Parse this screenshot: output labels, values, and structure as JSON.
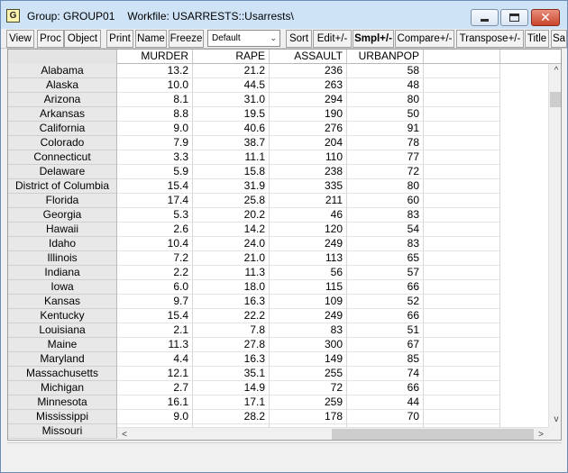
{
  "window": {
    "title_group": "Group: GROUP01",
    "title_workfile": "Workfile: USARRESTS::Usarrests\\",
    "app_icon_letter": "G"
  },
  "toolbar": {
    "view": "View",
    "proc": "Proc",
    "object": "Object",
    "print": "Print",
    "name": "Name",
    "freeze": "Freeze",
    "format_dropdown": "Default",
    "sort": "Sort",
    "edit": "Edit+/-",
    "smpl": "Smpl+/-",
    "compare": "Compare+/-",
    "transpose": "Transpose+/-",
    "title": "Title",
    "sa": "Sa"
  },
  "columns": [
    "MURDER",
    "RAPE",
    "ASSAULT",
    "URBANPOP"
  ],
  "rows": [
    {
      "label": "Alabama",
      "murder": "13.2",
      "rape": "21.2",
      "assault": "236",
      "urbanpop": "58"
    },
    {
      "label": "Alaska",
      "murder": "10.0",
      "rape": "44.5",
      "assault": "263",
      "urbanpop": "48"
    },
    {
      "label": "Arizona",
      "murder": "8.1",
      "rape": "31.0",
      "assault": "294",
      "urbanpop": "80"
    },
    {
      "label": "Arkansas",
      "murder": "8.8",
      "rape": "19.5",
      "assault": "190",
      "urbanpop": "50"
    },
    {
      "label": "California",
      "murder": "9.0",
      "rape": "40.6",
      "assault": "276",
      "urbanpop": "91"
    },
    {
      "label": "Colorado",
      "murder": "7.9",
      "rape": "38.7",
      "assault": "204",
      "urbanpop": "78"
    },
    {
      "label": "Connecticut",
      "murder": "3.3",
      "rape": "11.1",
      "assault": "110",
      "urbanpop": "77"
    },
    {
      "label": "Delaware",
      "murder": "5.9",
      "rape": "15.8",
      "assault": "238",
      "urbanpop": "72"
    },
    {
      "label": "District of Columbia",
      "murder": "15.4",
      "rape": "31.9",
      "assault": "335",
      "urbanpop": "80"
    },
    {
      "label": "Florida",
      "murder": "17.4",
      "rape": "25.8",
      "assault": "211",
      "urbanpop": "60"
    },
    {
      "label": "Georgia",
      "murder": "5.3",
      "rape": "20.2",
      "assault": "46",
      "urbanpop": "83"
    },
    {
      "label": "Hawaii",
      "murder": "2.6",
      "rape": "14.2",
      "assault": "120",
      "urbanpop": "54"
    },
    {
      "label": "Idaho",
      "murder": "10.4",
      "rape": "24.0",
      "assault": "249",
      "urbanpop": "83"
    },
    {
      "label": "Illinois",
      "murder": "7.2",
      "rape": "21.0",
      "assault": "113",
      "urbanpop": "65"
    },
    {
      "label": "Indiana",
      "murder": "2.2",
      "rape": "11.3",
      "assault": "56",
      "urbanpop": "57"
    },
    {
      "label": "Iowa",
      "murder": "6.0",
      "rape": "18.0",
      "assault": "115",
      "urbanpop": "66"
    },
    {
      "label": "Kansas",
      "murder": "9.7",
      "rape": "16.3",
      "assault": "109",
      "urbanpop": "52"
    },
    {
      "label": "Kentucky",
      "murder": "15.4",
      "rape": "22.2",
      "assault": "249",
      "urbanpop": "66"
    },
    {
      "label": "Louisiana",
      "murder": "2.1",
      "rape": "7.8",
      "assault": "83",
      "urbanpop": "51"
    },
    {
      "label": "Maine",
      "murder": "11.3",
      "rape": "27.8",
      "assault": "300",
      "urbanpop": "67"
    },
    {
      "label": "Maryland",
      "murder": "4.4",
      "rape": "16.3",
      "assault": "149",
      "urbanpop": "85"
    },
    {
      "label": "Massachusetts",
      "murder": "12.1",
      "rape": "35.1",
      "assault": "255",
      "urbanpop": "74"
    },
    {
      "label": "Michigan",
      "murder": "2.7",
      "rape": "14.9",
      "assault": "72",
      "urbanpop": "66"
    },
    {
      "label": "Minnesota",
      "murder": "16.1",
      "rape": "17.1",
      "assault": "259",
      "urbanpop": "44"
    },
    {
      "label": "Mississippi",
      "murder": "9.0",
      "rape": "28.2",
      "assault": "178",
      "urbanpop": "70"
    },
    {
      "label": "Missouri",
      "murder": "",
      "rape": "",
      "assault": "",
      "urbanpop": ""
    }
  ],
  "icons": {
    "minimize": "minimize-icon",
    "maximize": "maximize-icon",
    "close": "close-icon",
    "scroll_up": "chevron-up-icon",
    "scroll_down": "chevron-down-icon",
    "scroll_left": "chevron-left-icon",
    "scroll_right": "chevron-right-icon"
  },
  "colors": {
    "titlebar": "#cfe3f7",
    "close_button": "#c9452b",
    "row_header": "#e8e8e8"
  }
}
